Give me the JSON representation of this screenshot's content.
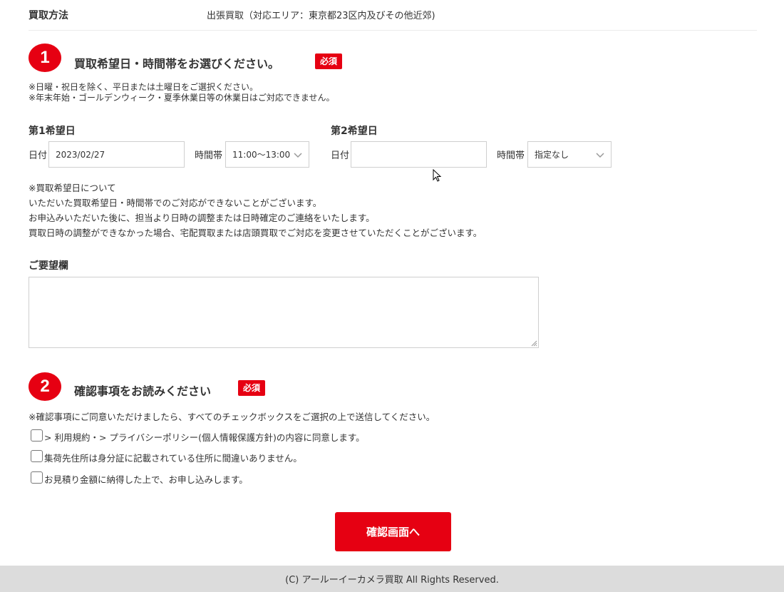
{
  "method": {
    "label": "買取方法",
    "value": "出張買取（対応エリア：東京都23区内及びその他近郊)"
  },
  "section1": {
    "number": "1",
    "title": "買取希望日・時間帯をお選びください。",
    "badge": "必須",
    "notes": [
      "※日曜・祝日を除く、平日または土曜日をご選択ください。",
      "※年末年始・ゴールデンウィーク・夏季休業日等の休業日はご対応できません。"
    ],
    "first": {
      "title": "第1希望日",
      "date_label": "日付",
      "date_value": "2023/02/27",
      "time_label": "時間帯",
      "time_value": "11:00〜13:00"
    },
    "second": {
      "title": "第2希望日",
      "date_label": "日付",
      "date_value": "",
      "time_label": "時間帯",
      "time_value": "指定なし"
    },
    "info": [
      "※買取希望日について",
      "いただいた買取希望日・時間帯でのご対応ができないことがございます。",
      "お申込みいただいた後に、担当より日時の調整または日時確定のご連絡をいたします。",
      "買取日時の調整ができなかった場合、宅配買取または店頭買取でご対応を変更させていただくことがございます。"
    ]
  },
  "request": {
    "title": "ご要望欄",
    "value": ""
  },
  "section2": {
    "number": "2",
    "title": "確認事項をお読みください",
    "badge": "必須",
    "note": "※確認事項にご同意いただけましたら、すべてのチェックボックスをご選択の上で送信してください。",
    "checkboxes": [
      {
        "label": "> 利用規約・> プライバシーポリシー(個人情報保護方針)の内容に同意します。",
        "checked": false
      },
      {
        "label": "集荷先住所は身分証に記載されている住所に間違いありません。",
        "checked": false
      },
      {
        "label": "お見積り金額に納得した上で、お申し込みします。",
        "checked": false
      }
    ]
  },
  "submit_label": "確認画面へ",
  "footer": "(C) アールーイーカメラ買取 All Rights Reserved.",
  "colors": {
    "accent": "#e60012",
    "footer_bg": "#dcdcdc"
  }
}
